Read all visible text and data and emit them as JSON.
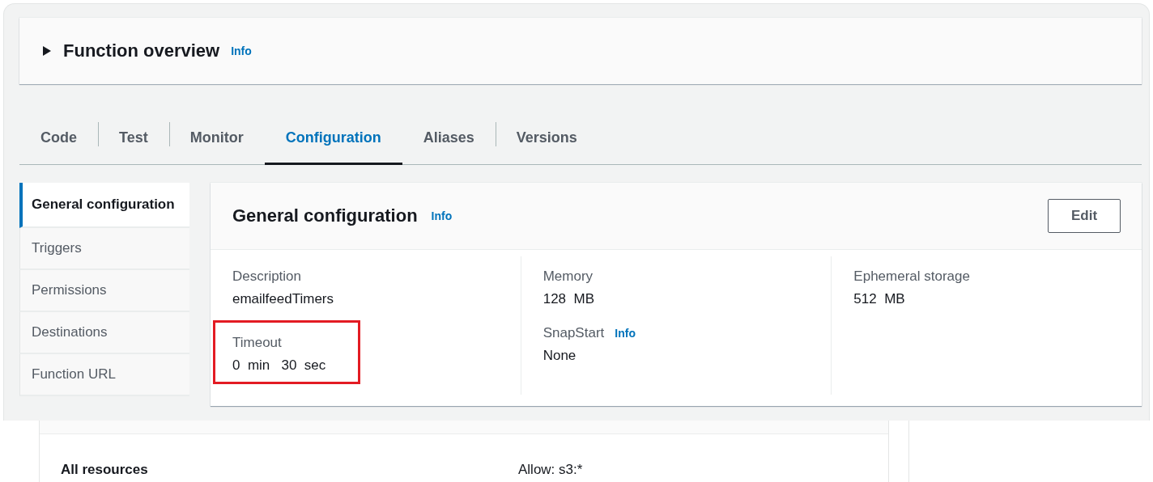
{
  "overview": {
    "expanded": false,
    "title": "Function overview",
    "info": "Info"
  },
  "tabs": [
    {
      "label": "Code",
      "selected": false
    },
    {
      "label": "Test",
      "selected": false
    },
    {
      "label": "Monitor",
      "selected": false
    },
    {
      "label": "Configuration",
      "selected": true
    },
    {
      "label": "Aliases",
      "selected": false
    },
    {
      "label": "Versions",
      "selected": false
    }
  ],
  "sidebar": {
    "items": [
      {
        "label": "General configuration",
        "selected": true
      },
      {
        "label": "Triggers",
        "selected": false
      },
      {
        "label": "Permissions",
        "selected": false
      },
      {
        "label": "Destinations",
        "selected": false
      },
      {
        "label": "Function URL",
        "selected": false
      }
    ]
  },
  "panel": {
    "title": "General configuration",
    "info": "Info",
    "edit_button": "Edit",
    "columns": [
      [
        {
          "label": "Description",
          "value": "emailfeedTimers",
          "highlighted": false
        },
        {
          "label": "Timeout",
          "value": "0  min   30  sec",
          "highlighted": true
        }
      ],
      [
        {
          "label": "Memory",
          "value": "128  MB",
          "highlighted": false
        },
        {
          "label": "SnapStart",
          "info": "Info",
          "value": "None",
          "highlighted": false
        }
      ],
      [
        {
          "label": "Ephemeral storage",
          "value": "512  MB",
          "highlighted": false
        }
      ]
    ]
  },
  "resources_table": {
    "rows": [
      {
        "resource": "All resources",
        "actions": "Allow: s3:*"
      }
    ]
  }
}
